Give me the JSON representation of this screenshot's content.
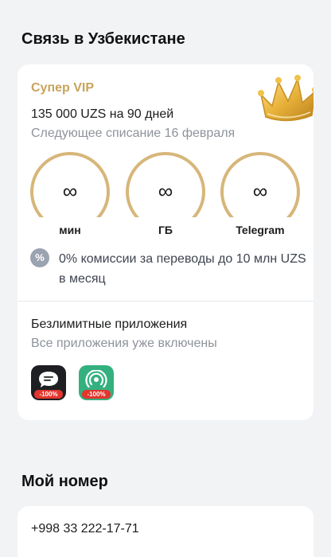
{
  "section_connect": {
    "title": "Связь в Узбекистане"
  },
  "plan": {
    "name": "Супер VIP",
    "price": "135 000 UZS на 90 дней",
    "next_charge": "Следующее списание 16 февраля",
    "accent_color": "#c9a35b",
    "crown_icon": "crown-icon",
    "gauges": [
      {
        "value": "∞",
        "label": "мин"
      },
      {
        "value": "∞",
        "label": "ГБ"
      },
      {
        "value": "∞",
        "label": "Telegram"
      }
    ],
    "promo": {
      "icon": "%",
      "text": "0% комиссии за переводы до 10 млн UZS в месяц"
    },
    "apps": {
      "title": "Безлимитные приложения",
      "subtitle": "Все приложения уже включены",
      "items": [
        {
          "icon": "chat-app-icon",
          "badge": "-100%",
          "color": "#1e1f22"
        },
        {
          "icon": "broadcast-app-icon",
          "badge": "-100%",
          "color": "#34b07f"
        }
      ]
    }
  },
  "section_number": {
    "title": "Мой номер",
    "phone": "+998 33 222-17-71"
  }
}
